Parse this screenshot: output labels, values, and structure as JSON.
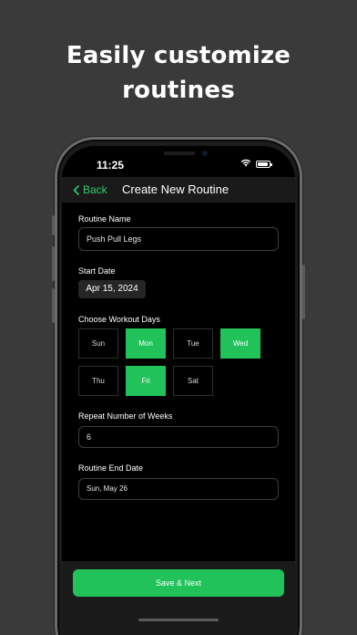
{
  "headline": {
    "line1": "Easily customize",
    "line2": "routines"
  },
  "status_bar": {
    "time": "11:25"
  },
  "navbar": {
    "back_label": "Back",
    "title": "Create New Routine",
    "accent_color": "#2ecc71"
  },
  "form": {
    "routine_name": {
      "label": "Routine Name",
      "value": "Push Pull Legs"
    },
    "start_date": {
      "label": "Start Date",
      "value": "Apr 15, 2024"
    },
    "workout_days": {
      "label": "Choose Workout Days",
      "days": [
        {
          "label": "Sun",
          "selected": false
        },
        {
          "label": "Mon",
          "selected": true
        },
        {
          "label": "Tue",
          "selected": false
        },
        {
          "label": "Wed",
          "selected": true
        },
        {
          "label": "Thu",
          "selected": false
        },
        {
          "label": "Fri",
          "selected": true
        },
        {
          "label": "Sat",
          "selected": false
        }
      ]
    },
    "repeat_weeks": {
      "label": "Repeat Number of Weeks",
      "value": "6"
    },
    "end_date": {
      "label": "Routine End Date",
      "value": "Sun, May 26"
    }
  },
  "footer": {
    "save_label": "Save & Next",
    "button_color": "#22c25b"
  }
}
